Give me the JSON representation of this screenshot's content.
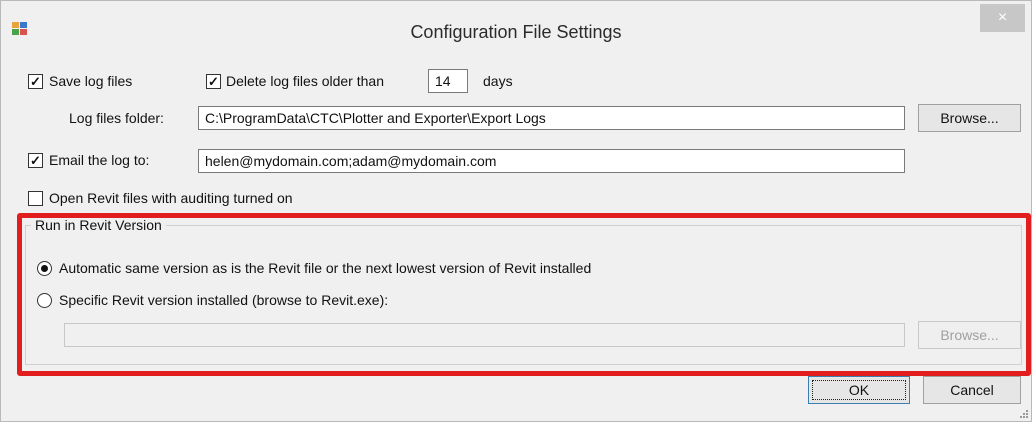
{
  "window": {
    "title": "Configuration File Settings",
    "close_glyph": "×"
  },
  "options": {
    "save_log_files": {
      "label": "Save log files",
      "checked": true
    },
    "delete_logs": {
      "label": "Delete log files older than",
      "checked": true,
      "days_value": "14",
      "days_suffix": "days"
    },
    "log_folder": {
      "label": "Log files folder:",
      "value": "C:\\ProgramData\\CTC\\Plotter and Exporter\\Export Logs",
      "browse_label": "Browse..."
    },
    "email_log": {
      "label": "Email the log to:",
      "checked": true,
      "value": "helen@mydomain.com;adam@mydomain.com"
    },
    "auditing": {
      "label": "Open Revit files with auditing turned on",
      "checked": false
    }
  },
  "revit_version": {
    "group_title": "Run in Revit Version",
    "automatic": {
      "label": "Automatic same version as is the Revit file or the next lowest version of Revit installed",
      "selected": true
    },
    "specific": {
      "label": "Specific Revit version installed (browse to Revit.exe):",
      "selected": false
    },
    "path_value": "",
    "browse_label": "Browse..."
  },
  "footer": {
    "ok_label": "OK",
    "cancel_label": "Cancel"
  },
  "colors": {
    "highlight": "#e21d1d",
    "window_bg": "#f0f0f0"
  },
  "icons": {
    "app": "app-icon",
    "close": "close-icon",
    "check": "checkmark-icon"
  }
}
